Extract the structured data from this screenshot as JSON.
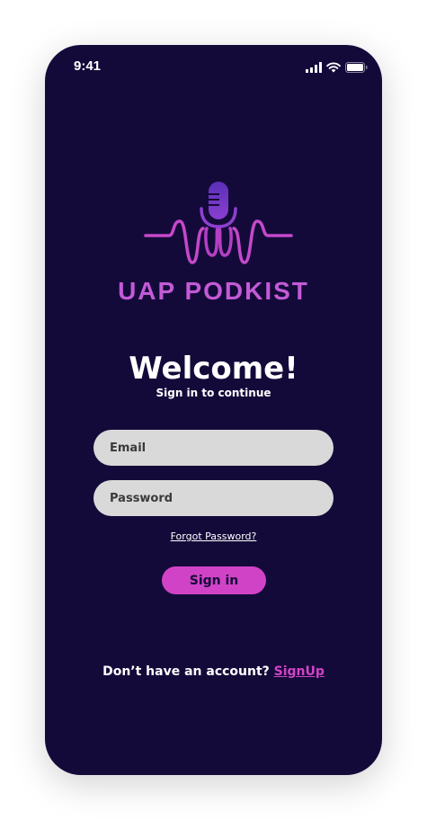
{
  "status_bar": {
    "time": "9:41"
  },
  "brand": {
    "name": "UAP PODKIST"
  },
  "welcome": {
    "title": "Welcome!",
    "subtitle": "Sign in to continue"
  },
  "form": {
    "email_placeholder": "Email",
    "email_value": "",
    "password_placeholder": "Password",
    "password_value": ""
  },
  "forgot_label": "Forgot Password?",
  "signin_label": "Sign in",
  "footer": {
    "prompt": "Don’t have an account?",
    "signup_label": "SignUp"
  },
  "colors": {
    "background": "#140a3a",
    "accent": "#d143c6",
    "brand": "#c35ad6",
    "field": "#d9d9d9"
  },
  "icons": [
    "cellular-signal-icon",
    "wifi-icon",
    "battery-icon",
    "microphone-icon"
  ]
}
